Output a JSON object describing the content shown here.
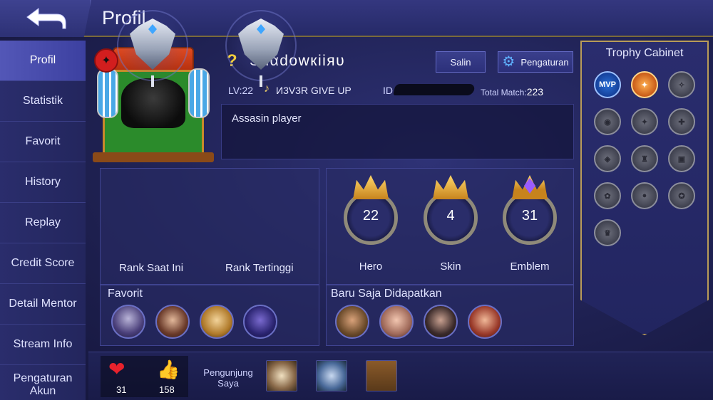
{
  "header": {
    "title": "Profil",
    "back_icon": "back-arrow-icon"
  },
  "sidebar": {
    "items": [
      {
        "label": "Profil",
        "active": true
      },
      {
        "label": "Statistik"
      },
      {
        "label": "Favorit"
      },
      {
        "label": "History"
      },
      {
        "label": "Replay"
      },
      {
        "label": "Credit Score"
      },
      {
        "label": "Detail Mentor"
      },
      {
        "label": "Stream Info"
      },
      {
        "label": "Pengaturan Akun"
      }
    ]
  },
  "profile": {
    "question_mark": "?",
    "name": "Sнαdowкiiяυ",
    "copy_label": "Salin",
    "settings_label": "Pengaturan",
    "level": "LV:22",
    "squad_icon": "♪",
    "squad": "И3V3R GIVE UP",
    "id_label": "ID",
    "total_match_label": "Total Match:",
    "total_match": "223",
    "bio": "Assasin player"
  },
  "ranks": [
    {
      "label": "Rank Saat Ini"
    },
    {
      "label": "Rank Tertinggi"
    }
  ],
  "stats": [
    {
      "value": "22",
      "label": "Hero"
    },
    {
      "value": "4",
      "label": "Skin"
    },
    {
      "value": "31",
      "label": "Emblem"
    }
  ],
  "favorite": {
    "title": "Favorit"
  },
  "recent": {
    "title": "Baru Saja Didapatkan"
  },
  "trophy": {
    "title": "Trophy Cabinet",
    "mvp_label": "MVP"
  },
  "footer": {
    "hearts": "31",
    "likes": "158",
    "visitors_label": "Pengunjung Saya"
  },
  "colors": {
    "accent_gold": "#b99c58",
    "active_tab": "#5357b7",
    "heart": "#e8222c"
  }
}
